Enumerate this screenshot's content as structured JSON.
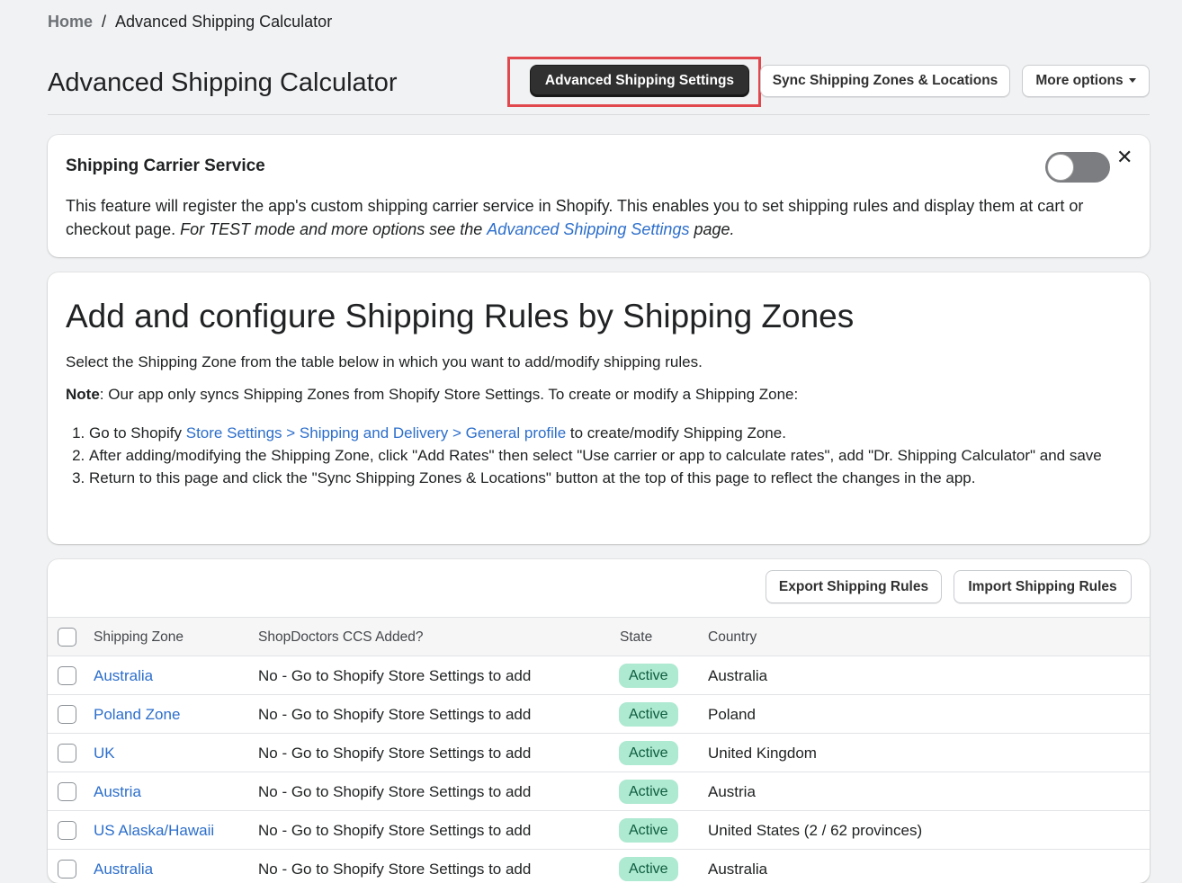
{
  "breadcrumb": {
    "home": "Home",
    "separator": "/",
    "current": "Advanced Shipping Calculator"
  },
  "page": {
    "title": "Advanced Shipping Calculator"
  },
  "header_actions": {
    "settings": "Advanced Shipping Settings",
    "sync": "Sync Shipping Zones & Locations",
    "more": "More options"
  },
  "carrier_card": {
    "title": "Shipping Carrier Service",
    "text_plain": "This feature will register the app's custom shipping carrier service in Shopify. This enables you to set shipping rules and display them at cart or checkout page.",
    "text_italic": "For TEST mode and more options see the",
    "link": "Advanced Shipping Settings",
    "text_end": "page.",
    "close": "✕",
    "toggle_enabled": false
  },
  "rules_card": {
    "heading": "Add and configure Shipping Rules by Shipping Zones",
    "select_text": "Select the Shipping Zone from the table below in which you want to add/modify shipping rules.",
    "note_label": "Note",
    "note_text": ": Our app only syncs Shipping Zones from Shopify Store Settings. To create or modify a Shipping Zone:",
    "steps": {
      "s1_pre": "Go to Shopify",
      "s1_link": "Store Settings > Shipping and Delivery > General profile",
      "s1_post": "to create/modify Shipping Zone.",
      "s2": "After adding/modifying the Shipping Zone, click \"Add Rates\" then select \"Use carrier or app to calculate rates\", add \"Dr. Shipping Calculator\" and save",
      "s3": "Return to this page and click the \"Sync Shipping Zones & Locations\" button at the top of this page to reflect the changes in the app."
    }
  },
  "table_card": {
    "export": "Export Shipping Rules",
    "import": "Import Shipping Rules",
    "columns": {
      "zone": "Shipping Zone",
      "ccs": "ShopDoctors CCS Added?",
      "state": "State",
      "country": "Country"
    },
    "rows": [
      {
        "zone": "Australia",
        "ccs": "No - Go to Shopify Store Settings to add",
        "state": "Active",
        "country": "Australia"
      },
      {
        "zone": "Poland Zone",
        "ccs": "No - Go to Shopify Store Settings to add",
        "state": "Active",
        "country": "Poland"
      },
      {
        "zone": "UK",
        "ccs": "No - Go to Shopify Store Settings to add",
        "state": "Active",
        "country": "United Kingdom"
      },
      {
        "zone": "Austria",
        "ccs": "No - Go to Shopify Store Settings to add",
        "state": "Active",
        "country": "Austria"
      },
      {
        "zone": "US Alaska/Hawaii",
        "ccs": "No - Go to Shopify Store Settings to add",
        "state": "Active",
        "country": "United States (2 / 62 provinces)"
      },
      {
        "zone": "Australia",
        "ccs": "No - Go to Shopify Store Settings to add",
        "state": "Active",
        "country": "Australia"
      }
    ]
  },
  "colors": {
    "link": "#2c6ecb",
    "badge_bg": "#aee9d1",
    "badge_text": "#0d5c3f",
    "primary_button": "#303030",
    "highlight": "#e0484d"
  }
}
